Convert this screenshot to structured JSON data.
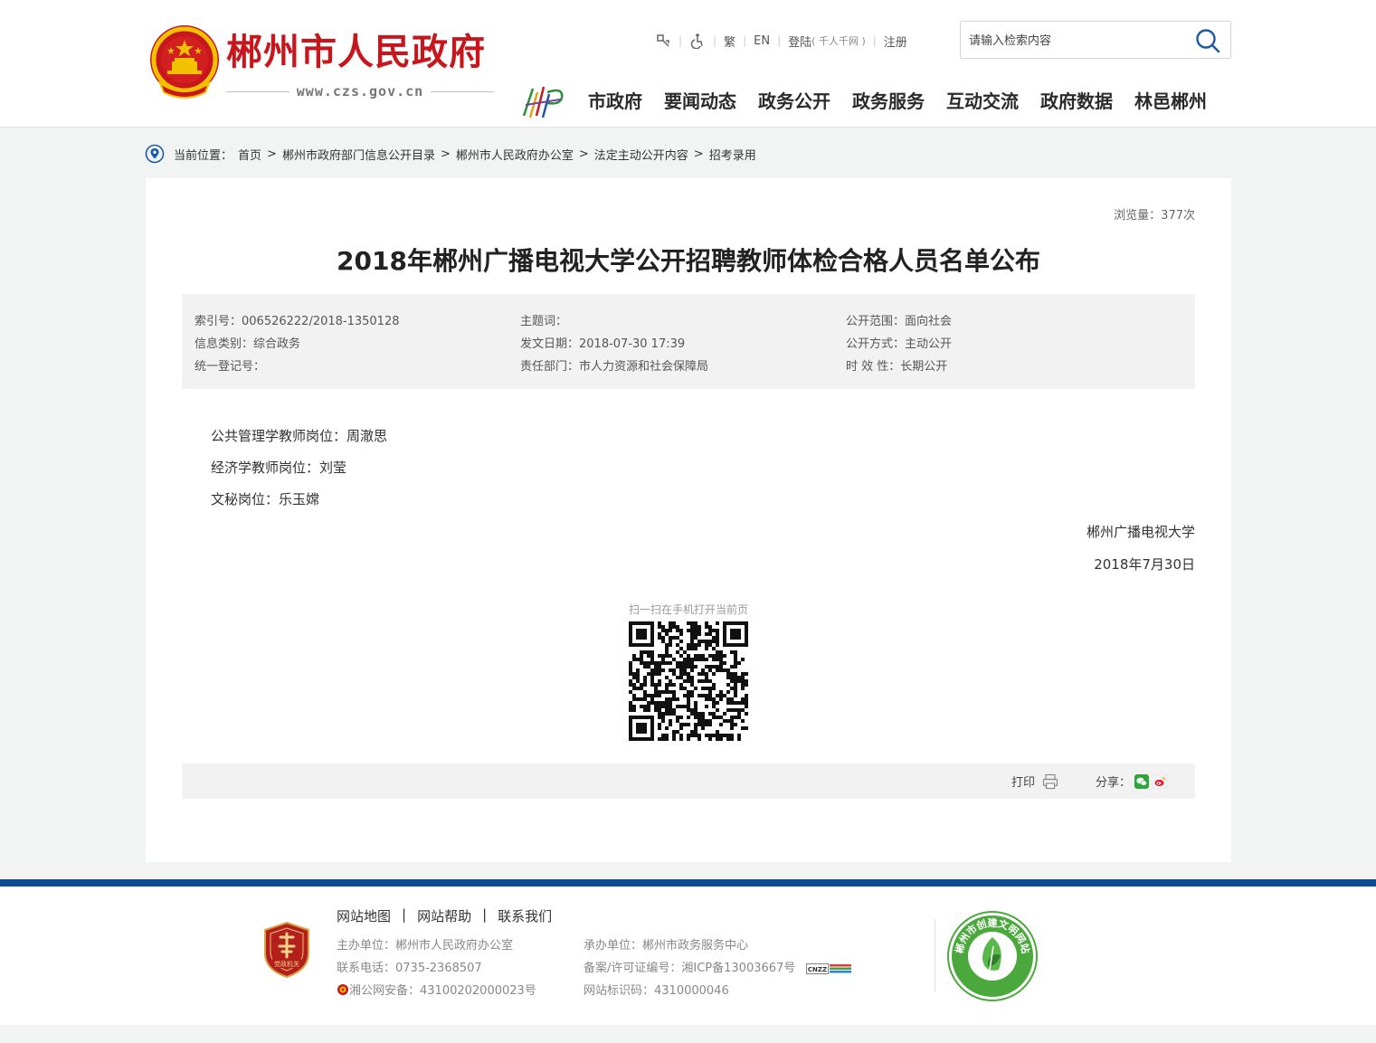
{
  "header": {
    "site_title": "郴州市人民政府",
    "site_url": "www.czs.gov.cn",
    "toplinks": {
      "traditional": "繁",
      "english": "EN",
      "login": "登陆",
      "login_note": "( 千人千网 )",
      "register": "注册"
    },
    "search": {
      "placeholder": "请输入检索内容"
    },
    "nav": [
      "市政府",
      "要闻动态",
      "政务公开",
      "政务服务",
      "互动交流",
      "政府数据",
      "林邑郴州"
    ]
  },
  "breadcrumb": {
    "label": "当前位置：",
    "items": [
      "首页",
      "郴州市政府部门信息公开目录",
      "郴州市人民政府办公室",
      "法定主动公开内容",
      "招考录用"
    ],
    "separator": ">"
  },
  "article": {
    "views": "浏览量：377次",
    "title": "2018年郴州广播电视大学公开招聘教师体检合格人员名单公布",
    "meta": {
      "index_no": "索引号：006526222/2018-1350128",
      "info_type": "信息类别：综合政务",
      "reg_no": "统一登记号：",
      "keywords": "主题词：",
      "pub_date": "发文日期：2018-07-30 17:39",
      "dept": "责任部门：市人力资源和社会保障局",
      "scope": "公开范围：面向社会",
      "method": "公开方式：主动公开",
      "validity": "时 效 性：长期公开"
    },
    "paragraphs": [
      "公共管理学教师岗位：周澈思",
      "经济学教师岗位：刘莹",
      "文秘岗位：乐玉嫦"
    ],
    "signature": "郴州广播电视大学",
    "date": "2018年7月30日",
    "qr_caption": "扫一扫在手机打开当前页",
    "print_label": "打印",
    "share_label": "分享："
  },
  "footer": {
    "links": [
      "网站地图",
      "网站帮助",
      "联系我们"
    ],
    "link_separator": "|",
    "host": "主办单位：郴州市人民政府办公室",
    "phone": "联系电话：0735-2368507",
    "police": "湘公网安备：43100202000023号",
    "organizer": "承办单位：郴州市政务服务中心",
    "icp": "备案/许可证编号：湘ICP备13003667号",
    "site_code": "网站标识码：4310000046",
    "party_badge_text": "党政机关",
    "civil_badge_text": "郴州市创建文明网站",
    "cnzz_text": "CNZZ"
  },
  "colors": {
    "brand_red": "#c8161d",
    "footer_blue": "#0f4a95",
    "search_icon": "#1b5aa8"
  }
}
